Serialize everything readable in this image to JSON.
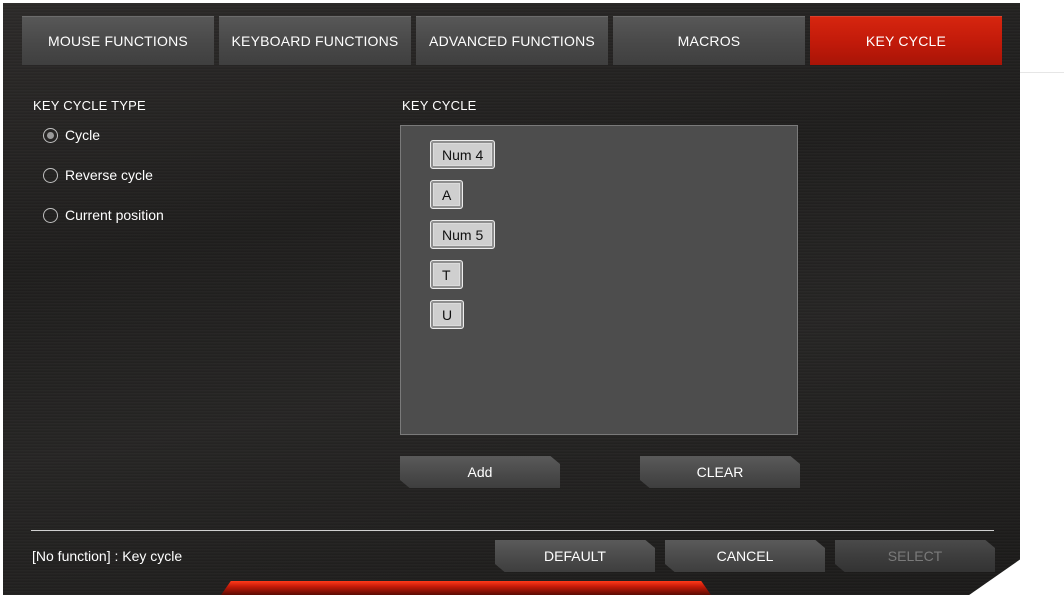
{
  "tabs": [
    {
      "label": "MOUSE FUNCTIONS",
      "active": false
    },
    {
      "label": "KEYBOARD FUNCTIONS",
      "active": false
    },
    {
      "label": "ADVANCED FUNCTIONS",
      "active": false
    },
    {
      "label": "MACROS",
      "active": false
    },
    {
      "label": "KEY CYCLE",
      "active": true
    }
  ],
  "key_cycle_type": {
    "title": "KEY CYCLE TYPE",
    "options": [
      {
        "label": "Cycle",
        "selected": true
      },
      {
        "label": "Reverse cycle",
        "selected": false
      },
      {
        "label": "Current position",
        "selected": false
      }
    ]
  },
  "key_cycle": {
    "title": "KEY CYCLE",
    "keys": [
      "Num 4",
      "A",
      "Num 5",
      "T",
      "U"
    ],
    "add_label": "Add",
    "clear_label": "CLEAR"
  },
  "footer": {
    "status": "[No function] : Key cycle",
    "default_label": "DEFAULT",
    "cancel_label": "CANCEL",
    "select_label": "SELECT",
    "select_enabled": false
  },
  "colors": {
    "accent": "#c11a0a",
    "background": "#222120",
    "panel": "#4d4d4d"
  }
}
